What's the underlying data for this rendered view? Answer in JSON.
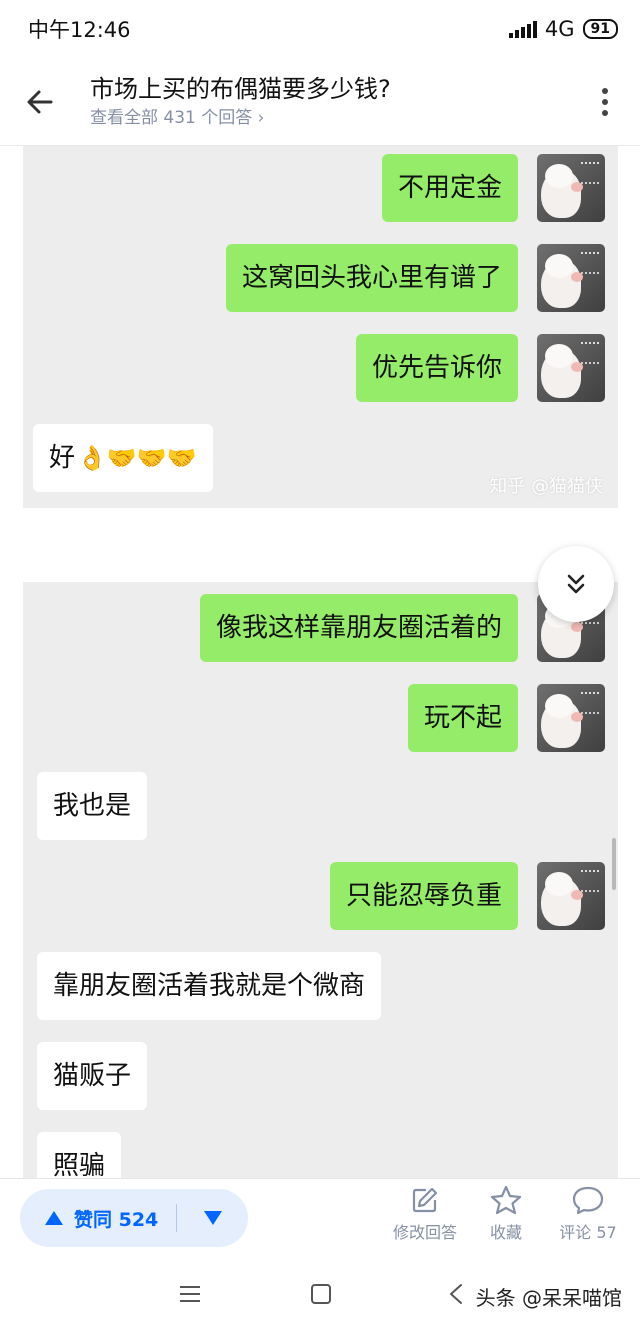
{
  "status": {
    "time": "中午12:46",
    "network": "4G",
    "battery": "91"
  },
  "header": {
    "title": "市场上买的布偶猫要多少钱?",
    "subtitle": "查看全部 431 个回答"
  },
  "chat1": {
    "messages": [
      {
        "side": "right",
        "text": "不用定金"
      },
      {
        "side": "right",
        "text": "这窝回头我心里有谱了"
      },
      {
        "side": "right",
        "text": "优先告诉你"
      },
      {
        "side": "left",
        "text": "好",
        "emoji": "👌🤝🤝🤝"
      }
    ],
    "watermark": "知乎 @猫猫侠"
  },
  "chat2": {
    "messages": [
      {
        "side": "right",
        "text": "像我这样靠朋友圈活着的"
      },
      {
        "side": "right",
        "text": "玩不起"
      },
      {
        "side": "left",
        "text": "我也是"
      },
      {
        "side": "right",
        "text": "只能忍辱负重"
      },
      {
        "side": "left",
        "text": "靠朋友圈活着我就是个微商"
      },
      {
        "side": "left",
        "text": "猫贩子"
      },
      {
        "side": "left",
        "text": "照骗"
      }
    ]
  },
  "actions": {
    "vote_label": "赞同 524",
    "edit_label": "修改回答",
    "favorite_label": "收藏",
    "comment_label": "评论 57"
  },
  "footer_watermark": "头条 @呆呆喵馆",
  "colors": {
    "accent": "#0066ff",
    "bubble_green": "#95ec69",
    "chat_bg": "#ededed"
  }
}
